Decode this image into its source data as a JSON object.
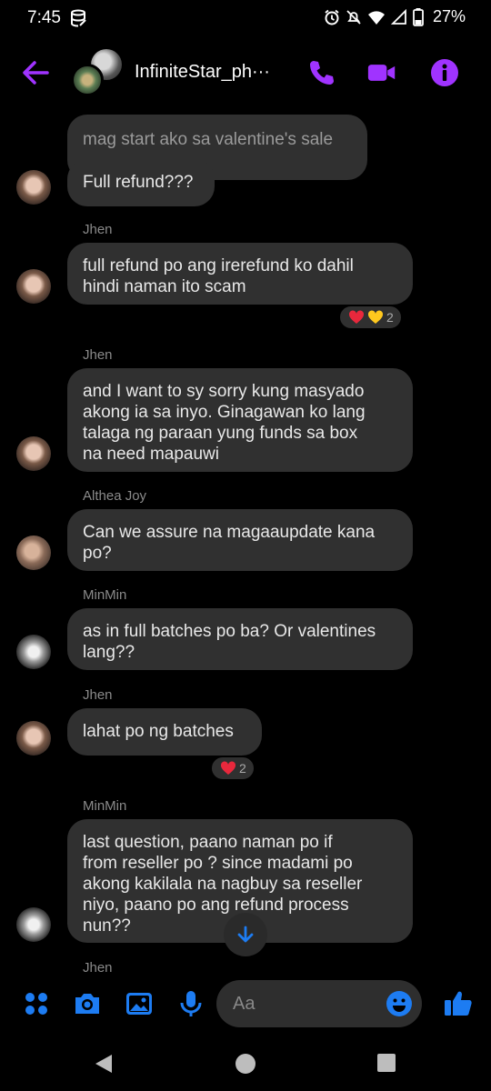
{
  "status_bar": {
    "time": "7:45",
    "battery": "27%"
  },
  "header": {
    "contact_name": "InfiniteStar_ph···",
    "accent_color": "#a033ff"
  },
  "messages": [
    {
      "sender": "",
      "text": "mag start ako sa valentine's sale"
    },
    {
      "sender": "",
      "text": "Full refund???"
    },
    {
      "sender": "Jhen",
      "lines": [
        "full refund po ang irerefund ko dahil",
        "hindi naman ito scam"
      ],
      "reactions": "2"
    },
    {
      "sender": "Jhen",
      "lines": [
        "and I want to sy sorry kung masyado",
        "akong ia sa inyo. Ginagawan ko lang",
        "talaga ng paraan yung funds sa box",
        "na need mapauwi"
      ]
    },
    {
      "sender": "Althea Joy",
      "lines": [
        "Can we assure na magaaupdate kana",
        "po?"
      ]
    },
    {
      "sender": "MinMin",
      "lines": [
        "as in full batches po ba? Or valentines",
        "lang??"
      ]
    },
    {
      "sender": "Jhen",
      "lines": [
        "lahat po ng batches"
      ],
      "reactions": "2"
    },
    {
      "sender": "MinMin",
      "lines": [
        "last question, paano naman po if",
        "from reseller po ? since madami po",
        "akong kakilala na nagbuy sa reseller",
        "niyo, paano po ang refund process",
        "nun??"
      ]
    },
    {
      "sender": "Jhen"
    }
  ],
  "composer": {
    "placeholder": "Aa",
    "icon_color": "#1d7cf2"
  }
}
